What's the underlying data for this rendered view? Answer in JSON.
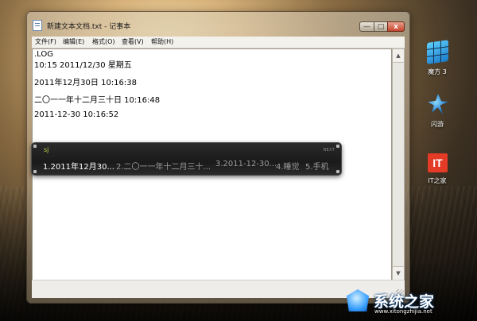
{
  "window": {
    "title": "新建文本文档.txt - 记事本",
    "controls": {
      "minimize": "—",
      "maximize": "□",
      "close": "x"
    }
  },
  "menu": [
    "文件(F)",
    "编辑(E)",
    "格式(O)",
    "查看(V)",
    "帮助(H)"
  ],
  "document": {
    "lines": [
      ".LOG",
      "10:15 2011/12/30 星期五",
      "2011年12月30日 10:16:38",
      "二〇一一年十二月三十日 10:16:48",
      "2011-12-30 10:16:52"
    ]
  },
  "ime": {
    "input": "sj",
    "next_label": "NEXT",
    "candidates": [
      "1.2011年12月30...",
      "2.二〇一一年十二月三十...",
      "3.2011-12-30...",
      "4.睡觉",
      "5.手机"
    ],
    "selected_index": 0
  },
  "desktop_icons": [
    {
      "label": "魔方 3",
      "icon": "rubiks-cube-icon"
    },
    {
      "label": "闪游",
      "icon": "flash-game-icon"
    },
    {
      "label": "IT之家",
      "icon": "it-home-icon",
      "logo_text": "IT"
    }
  ],
  "watermark": {
    "text": "系统之家",
    "url": "www.xitongzhijia.net",
    "icon": "xitongzhijia-logo-icon"
  },
  "colors": {
    "ime_background": "#1f1f1f",
    "ime_input": "#b9d84a",
    "close_button": "#c8452d",
    "it_logo": "#e33b26"
  }
}
